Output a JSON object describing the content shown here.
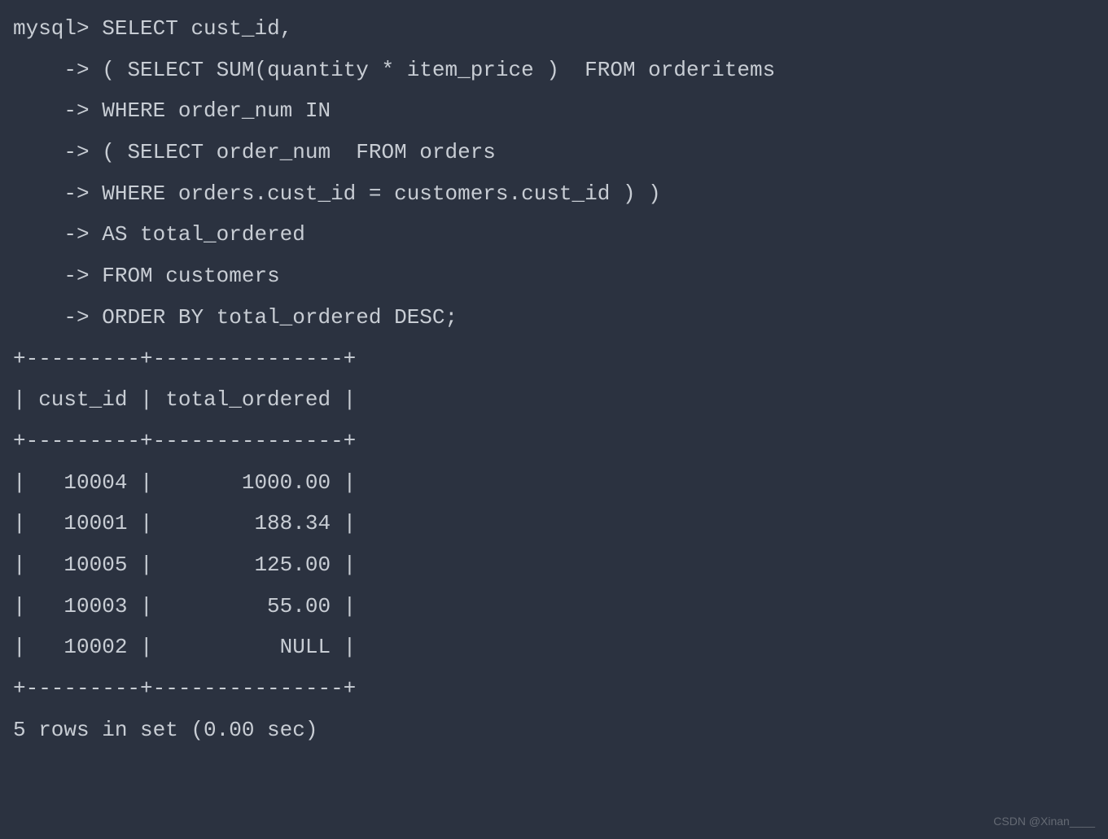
{
  "prompt": "mysql>",
  "continuation": "    ->",
  "query_lines": [
    "SELECT cust_id,",
    "( SELECT SUM(quantity * item_price )  FROM orderitems",
    "WHERE order_num IN",
    "( SELECT order_num  FROM orders",
    "WHERE orders.cust_id = customers.cust_id ) )",
    "AS total_ordered",
    "FROM customers",
    "ORDER BY total_ordered DESC;"
  ],
  "table": {
    "border_top": "+---------+---------------+",
    "headers": [
      "cust_id",
      "total_ordered"
    ],
    "header_line": "| cust_id | total_ordered |",
    "border_mid": "+---------+---------------+",
    "rows": [
      {
        "cust_id": "10004",
        "total_ordered": "1000.00"
      },
      {
        "cust_id": "10001",
        "total_ordered": "188.34"
      },
      {
        "cust_id": "10005",
        "total_ordered": "125.00"
      },
      {
        "cust_id": "10003",
        "total_ordered": "55.00"
      },
      {
        "cust_id": "10002",
        "total_ordered": "NULL"
      }
    ],
    "row_lines": [
      "|   10004 |       1000.00 |",
      "|   10001 |        188.34 |",
      "|   10005 |        125.00 |",
      "|   10003 |         55.00 |",
      "|   10002 |          NULL |"
    ],
    "border_bottom": "+---------+---------------+"
  },
  "status": "5 rows in set (0.00 sec)",
  "watermark": "CSDN @Xinan____"
}
